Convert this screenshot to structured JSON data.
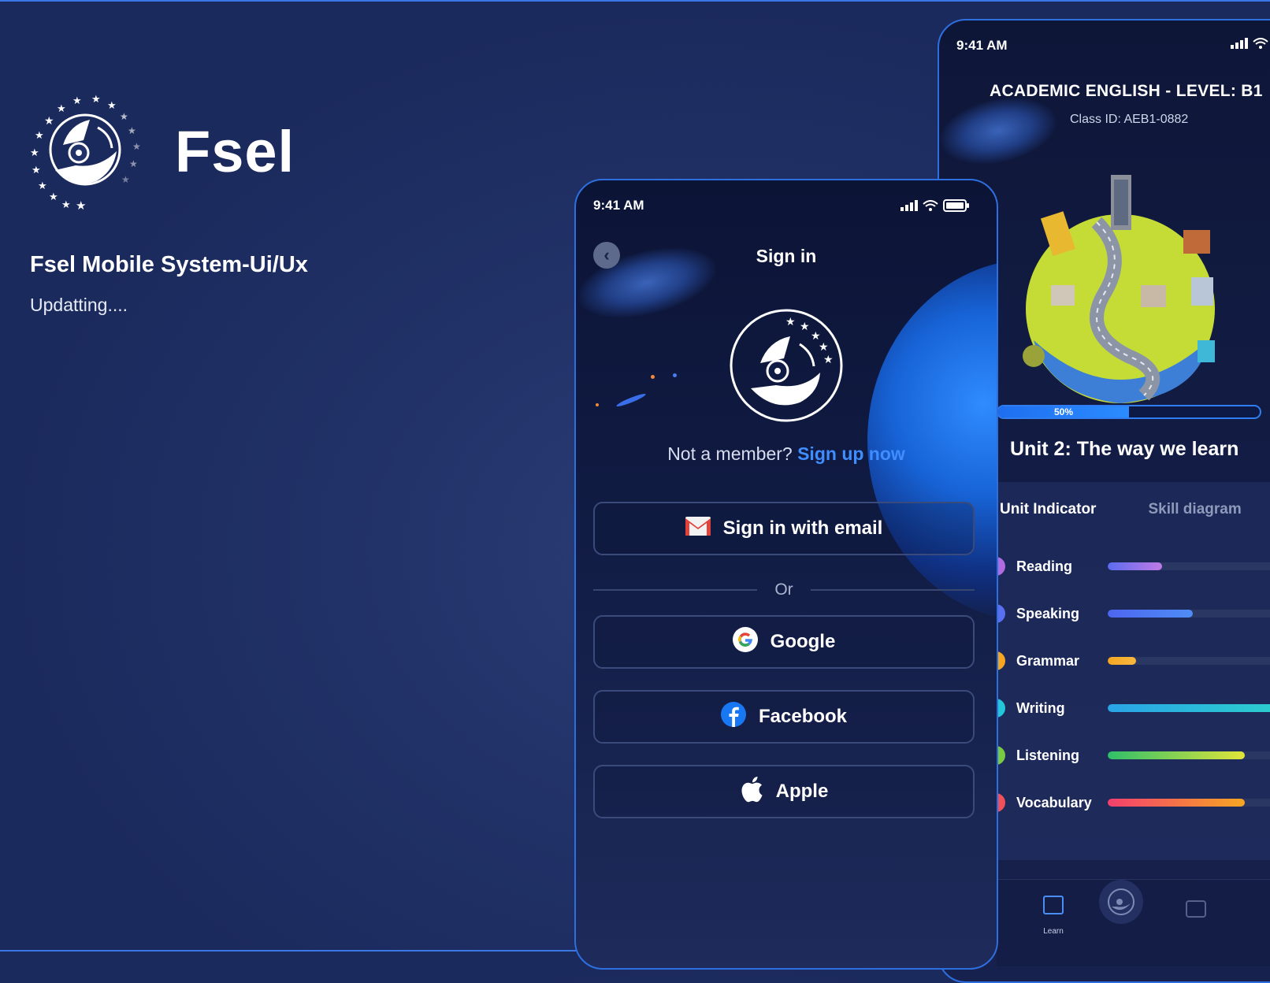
{
  "brand": {
    "name": "Fsel",
    "subtitle": "Fsel Mobile System-Ui/Ux",
    "status": "Updatting...."
  },
  "signin_screen": {
    "status_time": "9:41 AM",
    "title": "Sign in",
    "member_prompt": "Not a member?",
    "signup_link": "Sign up now",
    "email_button": "Sign in with email",
    "or_label": "Or",
    "google_button": "Google",
    "facebook_button": "Facebook",
    "apple_button": "Apple"
  },
  "course_screen": {
    "status_time": "9:41 AM",
    "course_title": "ACADEMIC ENGLISH - LEVEL: B1",
    "class_id": "Class ID: AEB1-0882",
    "progress_percent": 50,
    "progress_label": "50%",
    "unit_title": "Unit 2: The way we learn",
    "tabs": [
      {
        "label": "Unit Indicator",
        "active": true
      },
      {
        "label": "Skill diagram",
        "active": false
      }
    ],
    "skills": [
      {
        "label": "Reading",
        "value": 0.27,
        "color": "#b06ce0",
        "bar_from": "#5b6cf0",
        "bar_to": "#c07ae6"
      },
      {
        "label": "Speaking",
        "value": 0.42,
        "color": "#5a70f0",
        "bar_from": "#4d66f0",
        "bar_to": "#4f8cf5"
      },
      {
        "label": "Grammar",
        "value": 0.14,
        "color": "#f5a623",
        "bar_from": "#f5a623",
        "bar_to": "#f7b83e"
      },
      {
        "label": "Writing",
        "value": 1.0,
        "color": "#22c8d8",
        "bar_from": "#2aa4e8",
        "bar_to": "#2bd6c8"
      },
      {
        "label": "Listening",
        "value": 0.68,
        "color": "#7ac943",
        "bar_from": "#2fbf6a",
        "bar_to": "#e2e53a"
      },
      {
        "label": "Vocabulary",
        "value": 0.68,
        "color": "#f0505a",
        "bar_from": "#f43f6e",
        "bar_to": "#f5a623"
      }
    ],
    "nav": {
      "learn_label": "Learn"
    }
  }
}
